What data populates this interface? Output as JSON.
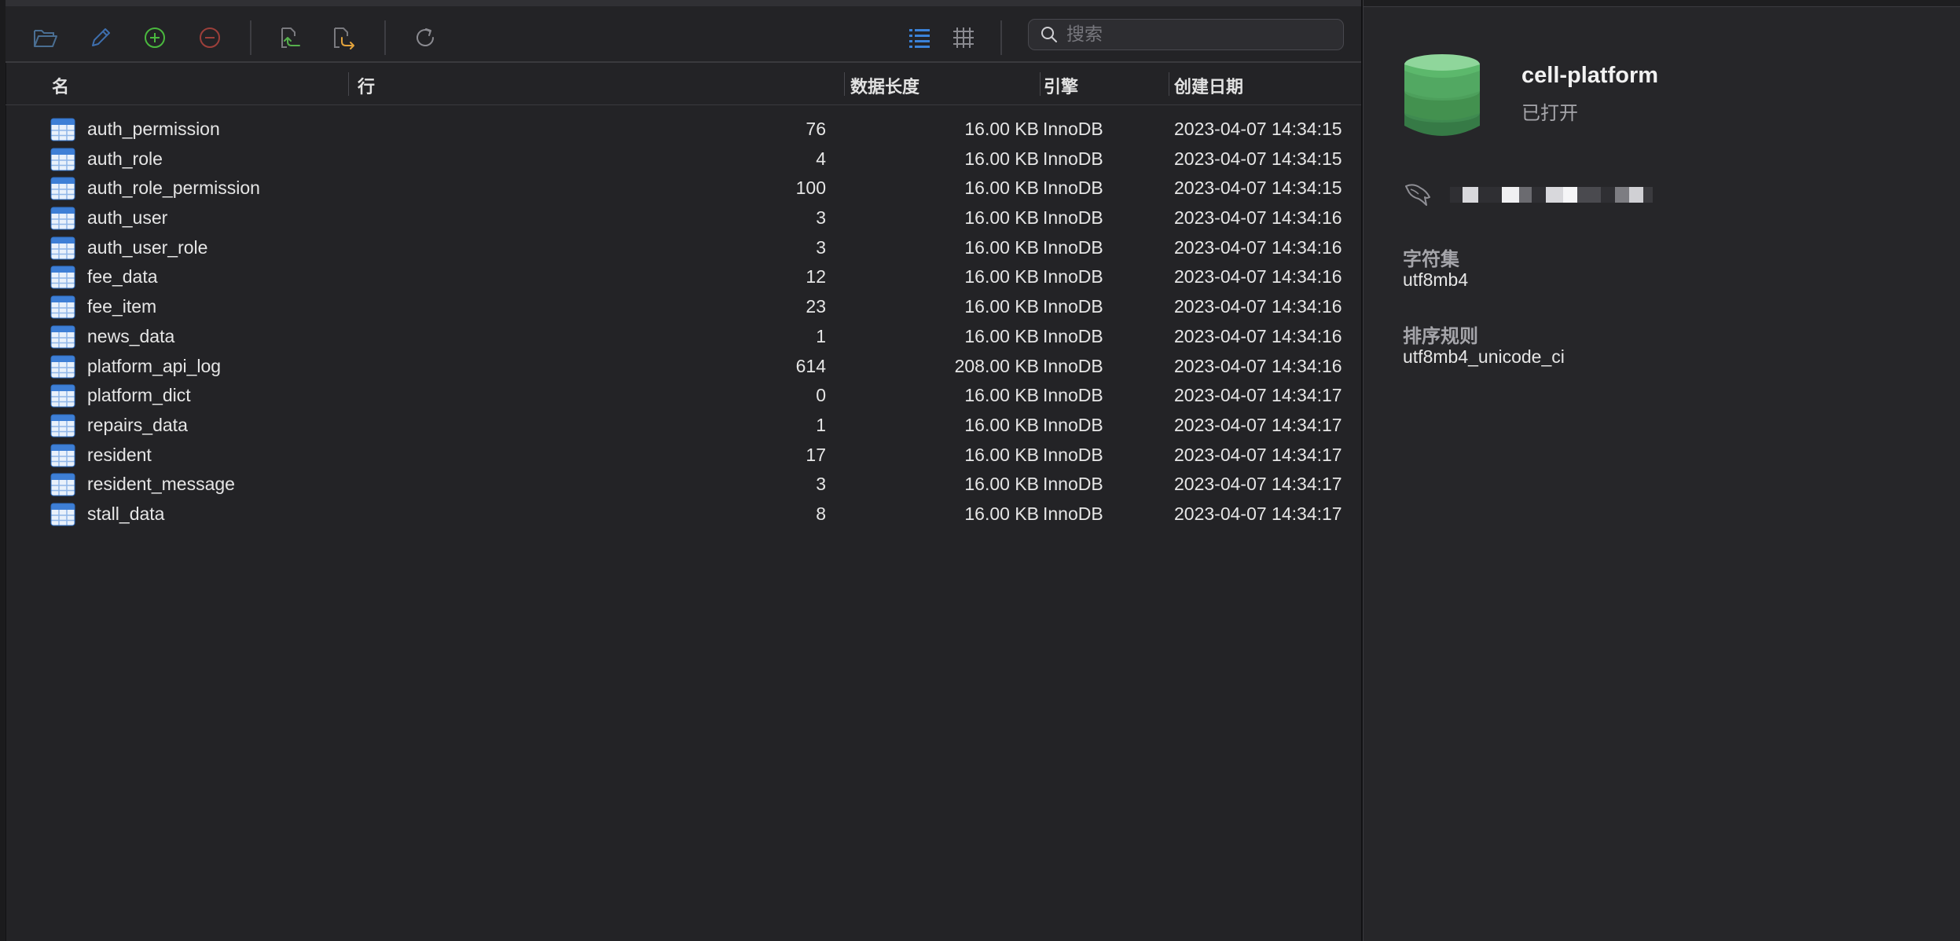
{
  "search": {
    "placeholder": "搜索",
    "value": ""
  },
  "columns": {
    "name": "名",
    "rows": "行",
    "data_length": "数据长度",
    "engine": "引擎",
    "created": "创建日期"
  },
  "tables": [
    {
      "name": "auth_permission",
      "rows": "76",
      "size": "16.00 KB",
      "engine": "InnoDB",
      "created": "2023-04-07 14:34:15"
    },
    {
      "name": "auth_role",
      "rows": "4",
      "size": "16.00 KB",
      "engine": "InnoDB",
      "created": "2023-04-07 14:34:15"
    },
    {
      "name": "auth_role_permission",
      "rows": "100",
      "size": "16.00 KB",
      "engine": "InnoDB",
      "created": "2023-04-07 14:34:15"
    },
    {
      "name": "auth_user",
      "rows": "3",
      "size": "16.00 KB",
      "engine": "InnoDB",
      "created": "2023-04-07 14:34:16"
    },
    {
      "name": "auth_user_role",
      "rows": "3",
      "size": "16.00 KB",
      "engine": "InnoDB",
      "created": "2023-04-07 14:34:16"
    },
    {
      "name": "fee_data",
      "rows": "12",
      "size": "16.00 KB",
      "engine": "InnoDB",
      "created": "2023-04-07 14:34:16"
    },
    {
      "name": "fee_item",
      "rows": "23",
      "size": "16.00 KB",
      "engine": "InnoDB",
      "created": "2023-04-07 14:34:16"
    },
    {
      "name": "news_data",
      "rows": "1",
      "size": "16.00 KB",
      "engine": "InnoDB",
      "created": "2023-04-07 14:34:16"
    },
    {
      "name": "platform_api_log",
      "rows": "614",
      "size": "208.00 KB",
      "engine": "InnoDB",
      "created": "2023-04-07 14:34:16"
    },
    {
      "name": "platform_dict",
      "rows": "0",
      "size": "16.00 KB",
      "engine": "InnoDB",
      "created": "2023-04-07 14:34:17"
    },
    {
      "name": "repairs_data",
      "rows": "1",
      "size": "16.00 KB",
      "engine": "InnoDB",
      "created": "2023-04-07 14:34:17"
    },
    {
      "name": "resident",
      "rows": "17",
      "size": "16.00 KB",
      "engine": "InnoDB",
      "created": "2023-04-07 14:34:17"
    },
    {
      "name": "resident_message",
      "rows": "3",
      "size": "16.00 KB",
      "engine": "InnoDB",
      "created": "2023-04-07 14:34:17"
    },
    {
      "name": "stall_data",
      "rows": "8",
      "size": "16.00 KB",
      "engine": "InnoDB",
      "created": "2023-04-07 14:34:17"
    }
  ],
  "info_panel": {
    "db_name": "cell-platform",
    "status": "已打开",
    "charset_label": "字符集",
    "charset_value": "utf8mb4",
    "collation_label": "排序规则",
    "collation_value": "utf8mb4_unicode_ci"
  },
  "icons": {
    "toolbar": [
      "open-table-icon",
      "design-table-icon",
      "new-table-icon",
      "delete-table-icon",
      "import-icon",
      "export-icon",
      "refresh-icon",
      "list-view-icon",
      "grid-view-icon",
      "search-icon"
    ],
    "table": "table-icon",
    "database": "database-icon",
    "connection": "connection-icon"
  },
  "colors": {
    "add": "#4ab83e",
    "delete": "#b8463f",
    "design": "#3e77c0",
    "import": "#56b04c",
    "export": "#e3a33c",
    "list_active": "#3b82d8",
    "db_green": "#59b66a"
  }
}
